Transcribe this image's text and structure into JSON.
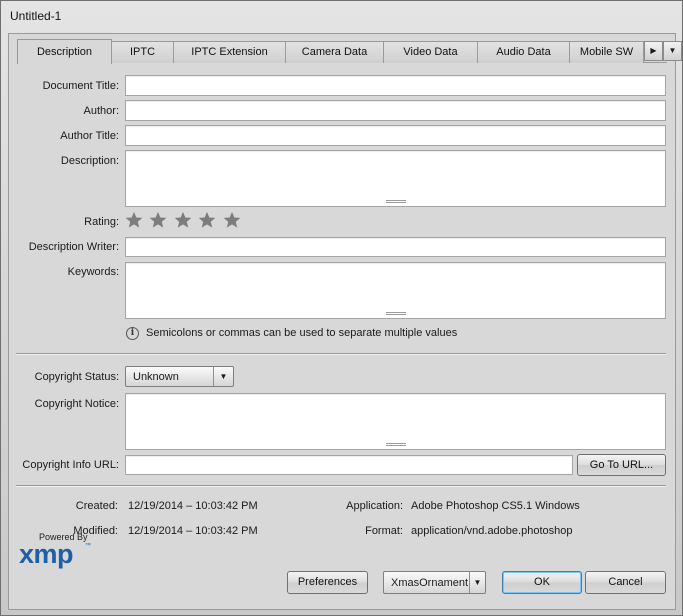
{
  "window": {
    "title": "Untitled-1"
  },
  "tabs": [
    {
      "label": "Description",
      "active": true
    },
    {
      "label": "IPTC"
    },
    {
      "label": "IPTC Extension"
    },
    {
      "label": "Camera Data"
    },
    {
      "label": "Video Data"
    },
    {
      "label": "Audio Data"
    },
    {
      "label": "Mobile SW"
    }
  ],
  "tab_scroll": {
    "next_icon": "triangle-right-icon",
    "menu_icon": "triangle-down-icon"
  },
  "fields": {
    "document_title": {
      "label": "Document Title:",
      "value": ""
    },
    "author": {
      "label": "Author:",
      "value": ""
    },
    "author_title": {
      "label": "Author Title:",
      "value": ""
    },
    "description": {
      "label": "Description:",
      "value": ""
    },
    "rating": {
      "label": "Rating:",
      "value": 0,
      "max": 5
    },
    "description_writer": {
      "label": "Description Writer:",
      "value": ""
    },
    "keywords": {
      "label": "Keywords:",
      "value": ""
    },
    "keywords_hint": "Semicolons or commas can be used to separate multiple values",
    "copyright_status": {
      "label": "Copyright Status:",
      "value": "Unknown"
    },
    "copyright_notice": {
      "label": "Copyright Notice:",
      "value": ""
    },
    "copyright_url": {
      "label": "Copyright Info URL:",
      "value": "",
      "button": "Go To URL..."
    }
  },
  "file_info": {
    "created_label": "Created:",
    "created_value": "12/19/2014 – 10:03:42 PM",
    "modified_label": "Modified:",
    "modified_value": "12/19/2014 – 10:03:42 PM",
    "application_label": "Application:",
    "application_value": "Adobe Photoshop CS5.1 Windows",
    "format_label": "Format:",
    "format_value": "application/vnd.adobe.photoshop"
  },
  "footer": {
    "logo_powered": "Powered By",
    "logo_name": "xmp",
    "logo_tm": "™",
    "preferences": "Preferences",
    "template_value": "XmasOrnament",
    "ok": "OK",
    "cancel": "Cancel"
  },
  "colors": {
    "logo_blue": "#1f5fa8",
    "star_gray": "#7d7d7d",
    "default_button_glow": "#79c6f5"
  }
}
